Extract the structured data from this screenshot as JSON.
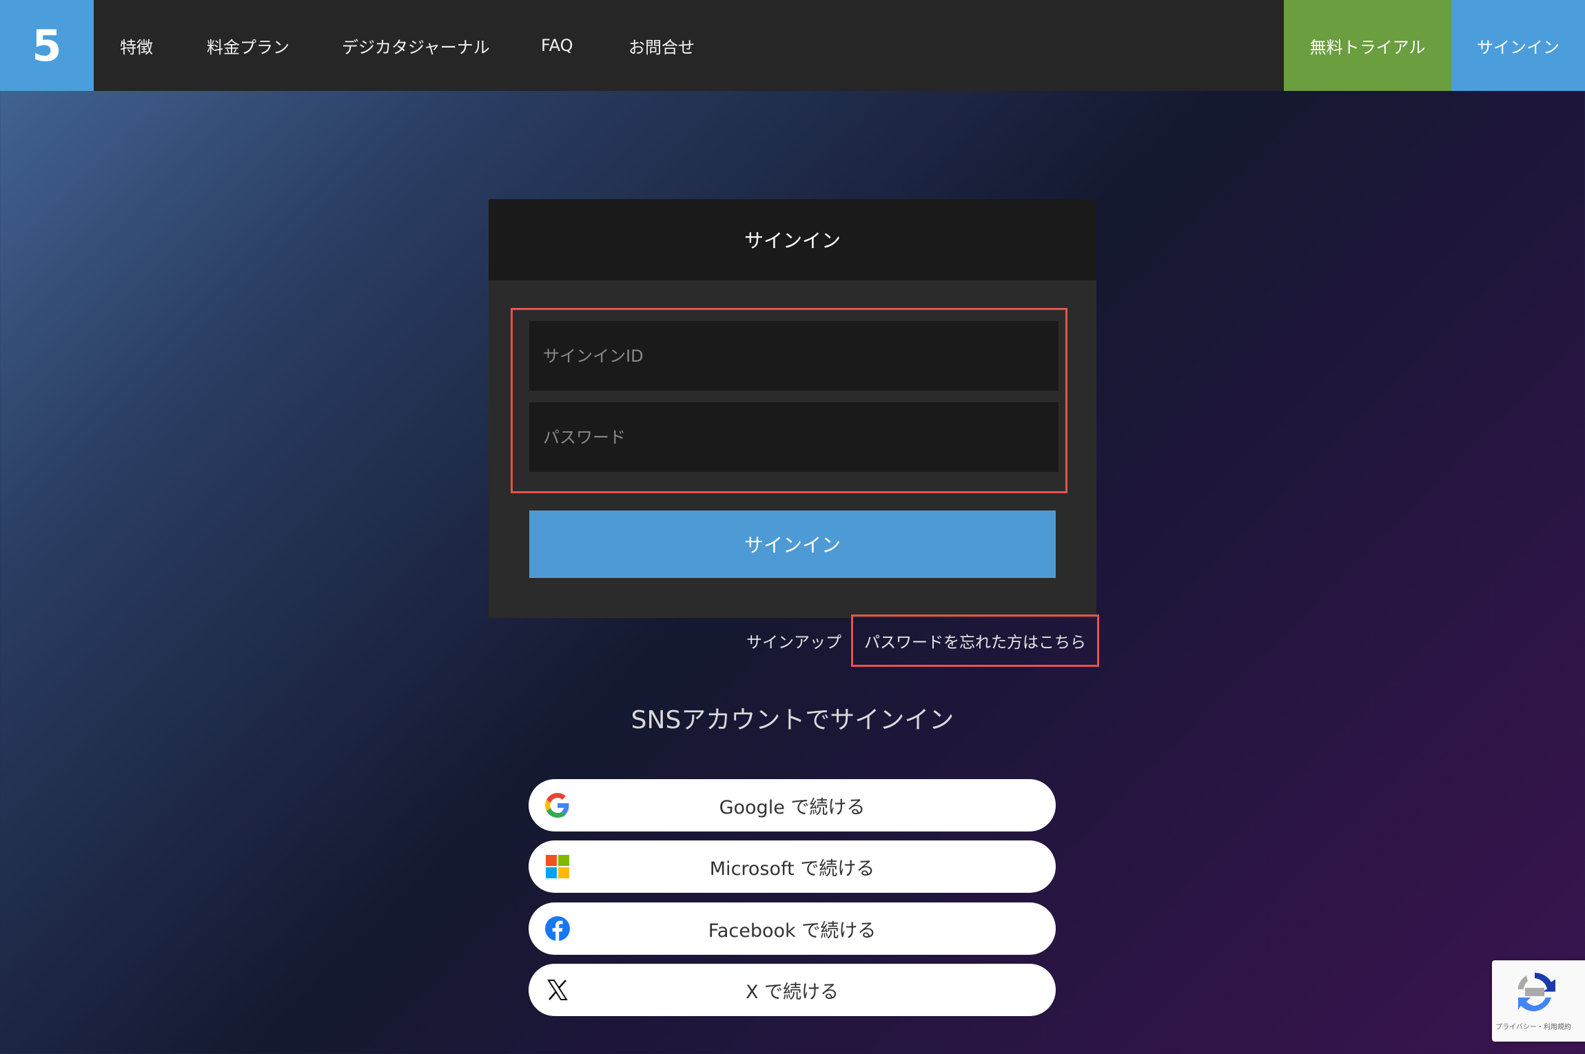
{
  "header": {
    "logo_text": "5",
    "nav": [
      {
        "label": "特徴"
      },
      {
        "label": "料金プラン"
      },
      {
        "label": "デジカタジャーナル"
      },
      {
        "label": "FAQ"
      },
      {
        "label": "お問合せ"
      }
    ],
    "trial_label": "無料トライアル",
    "signin_label": "サインイン"
  },
  "signin_form": {
    "title": "サインイン",
    "id_placeholder": "サインインID",
    "password_placeholder": "パスワード",
    "submit_label": "サインイン"
  },
  "links": {
    "signup": "サインアップ",
    "forgot_password": "パスワードを忘れた方はこちら"
  },
  "sns": {
    "title": "SNSアカウントでサインイン",
    "buttons": [
      {
        "label": "Google で続ける",
        "icon": "google-icon"
      },
      {
        "label": "Microsoft で続ける",
        "icon": "microsoft-icon"
      },
      {
        "label": "Facebook で続ける",
        "icon": "facebook-icon"
      },
      {
        "label": "X で続ける",
        "icon": "x-icon"
      }
    ]
  },
  "recaptcha": {
    "text": "プライバシー・利用規約"
  },
  "colors": {
    "brand_blue": "#4b9edb",
    "trial_green": "#6a9e3f",
    "highlight_red": "#e8534a"
  }
}
